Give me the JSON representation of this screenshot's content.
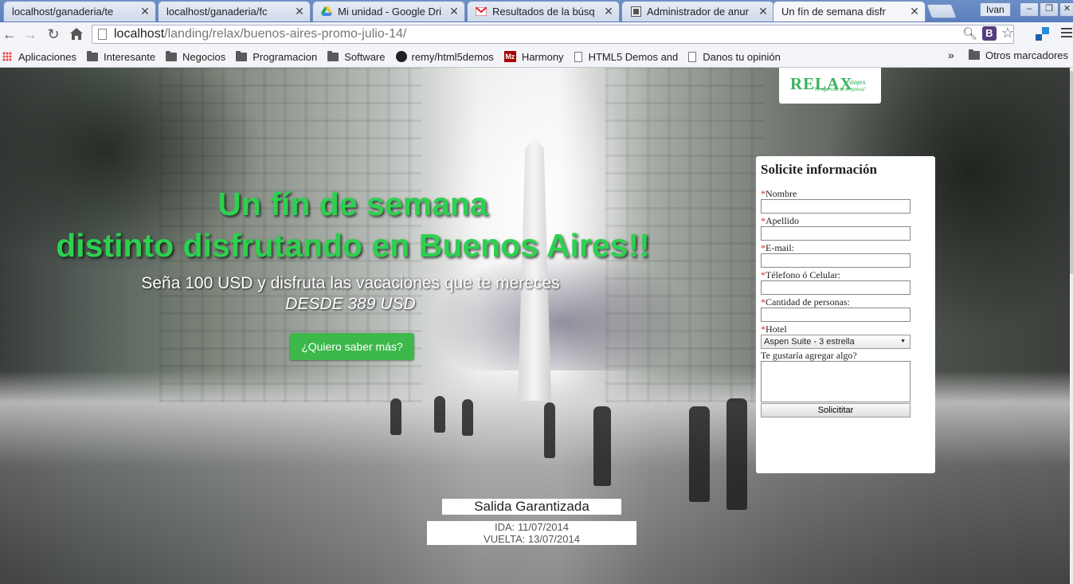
{
  "browser": {
    "tabs": [
      {
        "label": "localhost/ganaderia/te",
        "icon": "page-icon",
        "active": false
      },
      {
        "label": "localhost/ganaderia/fc",
        "icon": "page-icon",
        "active": false
      },
      {
        "label": "Mi unidad - Google Dri",
        "icon": "google-drive-icon",
        "active": false
      },
      {
        "label": "Resultados de la búsq",
        "icon": "gmail-icon",
        "active": false
      },
      {
        "label": "Administrador de anur",
        "icon": "admin-icon",
        "active": false
      },
      {
        "label": "Un fín de semana disfr",
        "icon": "page-icon",
        "active": true
      }
    ],
    "user": "Ivan",
    "url_host": "localhost",
    "url_path": "/landing/relax/buenos-aires-promo-julio-14/",
    "bookmarks": [
      {
        "label": "Aplicaciones",
        "icon": "apps-icon"
      },
      {
        "label": "Interesante",
        "icon": "folder-icon"
      },
      {
        "label": "Negocios",
        "icon": "folder-icon"
      },
      {
        "label": "Programacion",
        "icon": "folder-icon"
      },
      {
        "label": "Software",
        "icon": "folder-icon"
      },
      {
        "label": "remy/html5demos",
        "icon": "github-icon"
      },
      {
        "label": "Harmony",
        "icon": "mozilla-icon"
      },
      {
        "label": "HTML5 Demos and",
        "icon": "page-icon"
      },
      {
        "label": "Danos tu opinión",
        "icon": "page-icon"
      }
    ],
    "bookmarks_more": "»",
    "other_bookmarks": "Otros marcadores"
  },
  "page": {
    "logo": {
      "name": "RELAX",
      "sub": "viajes",
      "tagline": "\"Tu agencia, tu empresa\""
    },
    "hero": {
      "title_line1": "Un fín de semana",
      "title_line2": "distinto disfrutando en Buenos Aires!!",
      "subtitle": "Seña 100 USD y disfruta las vacaciones que te mereces",
      "price": "DESDE 389 USD",
      "cta": "¿Quiero saber más?"
    },
    "departure": {
      "title": "Salida Garantizada",
      "ida": "IDA: 11/07/2014",
      "vuelta": "VUELTA: 13/07/2014"
    },
    "form": {
      "title": "Solicite información",
      "fields": [
        {
          "label": "Nombre",
          "required": true
        },
        {
          "label": "Apellido",
          "required": true
        },
        {
          "label": "E-mail:",
          "required": true
        },
        {
          "label": "Télefono ó Celular:",
          "required": true
        },
        {
          "label": "Cantidad de personas:",
          "required": true
        }
      ],
      "hotel_label": "Hotel",
      "hotel_selected": "Aspen Suite - 3 estrella",
      "comments_label": "Te gustaría agregar algo?",
      "submit": "Solicititar",
      "required_mark": "*"
    },
    "colors": {
      "accent_green": "#2ed04f",
      "button_green": "#3db84a"
    }
  }
}
